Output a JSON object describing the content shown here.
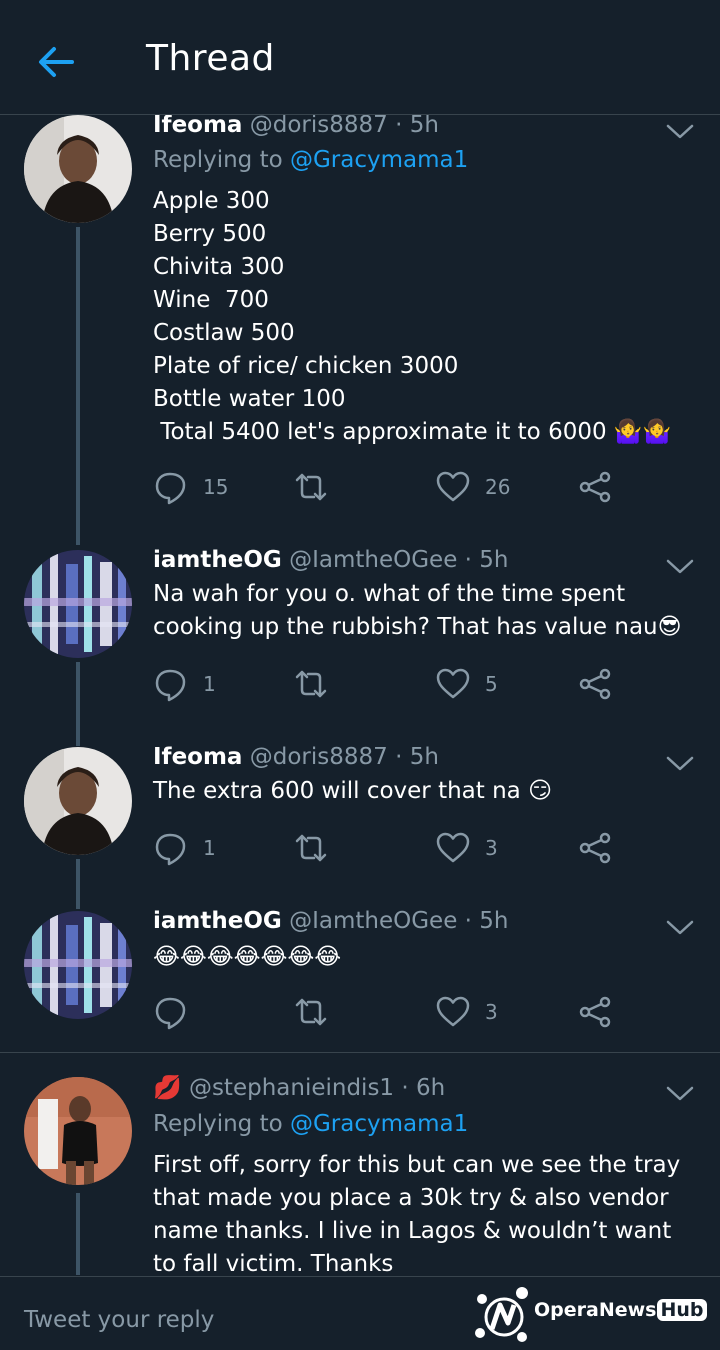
{
  "header": {
    "title": "Thread"
  },
  "tweets": [
    {
      "name": "Ifeoma",
      "handle": "@doris8887",
      "dot": "·",
      "time": "5h",
      "replying_prefix": "Replying to ",
      "replying_to": "@Gracymama1",
      "lines": [
        "Apple 300",
        "Berry 500",
        "Chivita 300",
        "Wine  700",
        "Costlaw 500",
        "Plate of rice/ chicken 3000",
        "Bottle water 100",
        " Total 5400 let's approximate it to 6000 🤷‍♀️🤷‍♀️"
      ],
      "reply_count": "15",
      "retweet_count": "",
      "like_count": "26"
    },
    {
      "name": "iamtheOG",
      "handle": "@IamtheOGee",
      "dot": "·",
      "time": "5h",
      "lines": [
        "Na wah for you o. what of the time spent cooking up the rubbish? That has value nau😎"
      ],
      "reply_count": "1",
      "retweet_count": "",
      "like_count": "5"
    },
    {
      "name": "Ifeoma",
      "handle": "@doris8887",
      "dot": "·",
      "time": "5h",
      "lines": [
        "The extra 600 will cover that na 😏"
      ],
      "reply_count": "1",
      "retweet_count": "",
      "like_count": "3"
    },
    {
      "name": "iamtheOG",
      "handle": "@IamtheOGee",
      "dot": "·",
      "time": "5h",
      "lines": [
        "😂😂😂😂😂😂😂"
      ],
      "reply_count": "",
      "retweet_count": "",
      "like_count": "3"
    },
    {
      "name": "💋",
      "handle": "@stephanieindis1",
      "dot": "·",
      "time": "6h",
      "replying_prefix": "Replying to ",
      "replying_to": "@Gracymama1",
      "lines": [
        "First off, sorry for this but can we see the tray that made you place a 30k try & also vendor name thanks. I live in Lagos & wouldn’t want to fall victim. Thanks"
      ]
    }
  ],
  "reply_bar": {
    "placeholder": "Tweet your reply"
  },
  "watermark": {
    "brand": "OperaNews",
    "hub": "Hub"
  },
  "icons": {
    "back": "arrow-left-icon",
    "caret": "chevron-down-icon",
    "reply": "speech-bubble-icon",
    "retweet": "retweet-icon",
    "like": "heart-icon",
    "share": "share-icon"
  },
  "colors": {
    "background": "#15202b",
    "accent": "#1da1f2",
    "muted": "#8899a6",
    "thread_line": "#3d5466",
    "divider": "#38444d"
  }
}
